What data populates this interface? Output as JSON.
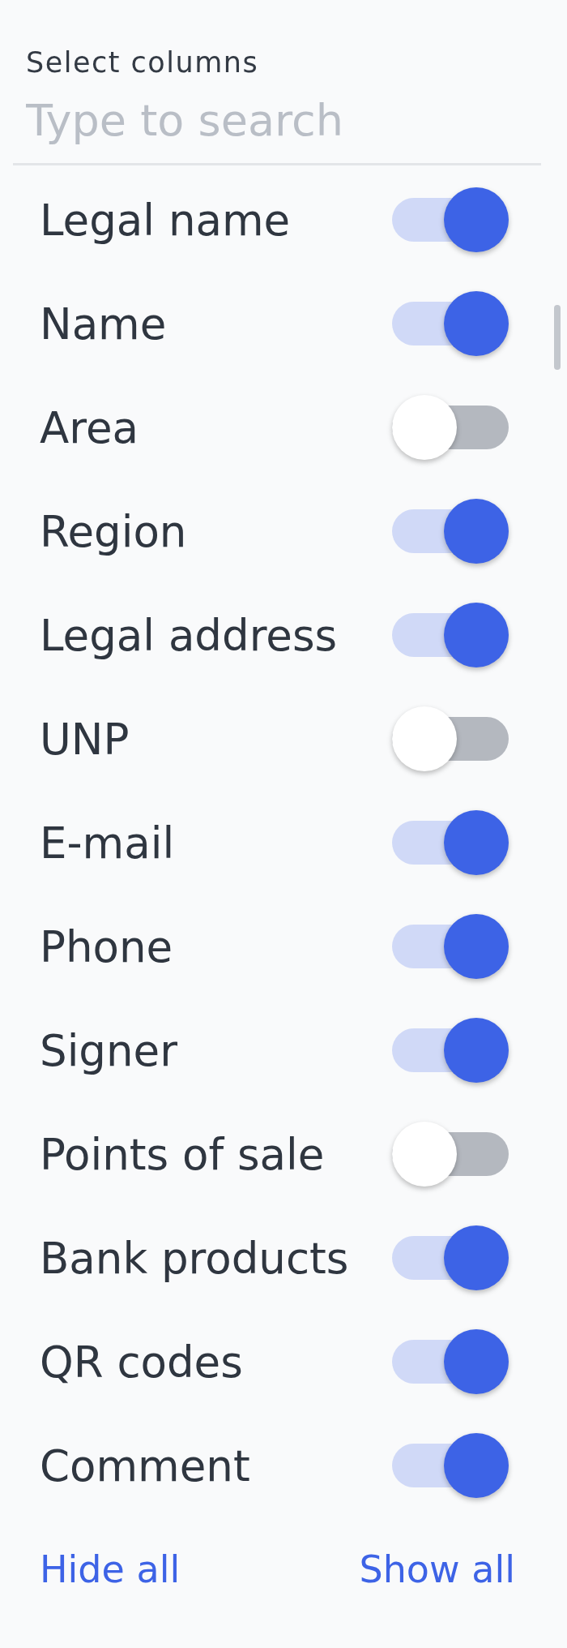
{
  "title": "Select columns",
  "search": {
    "placeholder": "Type to search"
  },
  "columns": [
    {
      "label": "Legal name",
      "on": true
    },
    {
      "label": "Name",
      "on": true
    },
    {
      "label": "Area",
      "on": false
    },
    {
      "label": "Region",
      "on": true
    },
    {
      "label": "Legal address",
      "on": true
    },
    {
      "label": "UNP",
      "on": false
    },
    {
      "label": "E-mail",
      "on": true
    },
    {
      "label": "Phone",
      "on": true
    },
    {
      "label": "Signer",
      "on": true
    },
    {
      "label": "Points of sale",
      "on": false
    },
    {
      "label": "Bank products",
      "on": true
    },
    {
      "label": "QR codes",
      "on": true
    },
    {
      "label": "Comment",
      "on": true
    }
  ],
  "actions": [
    "Hide all",
    "Show all"
  ]
}
